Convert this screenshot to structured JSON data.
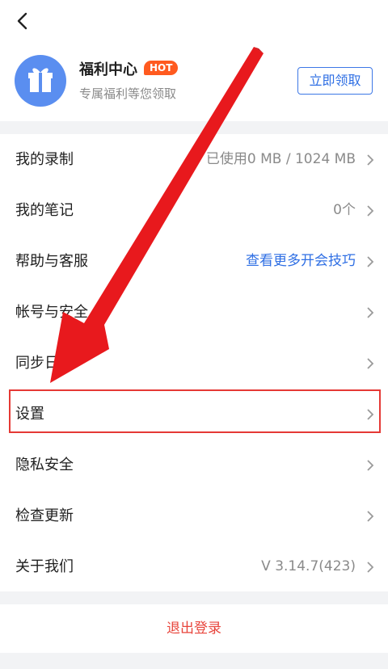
{
  "header": {
    "back_icon": "chevron-left-icon"
  },
  "welfare": {
    "icon": "gift-icon",
    "title": "福利中心",
    "badge": "HOT",
    "subtitle": "专属福利等您领取",
    "claim_button": "立即领取"
  },
  "menu": [
    {
      "label": "我的录制",
      "value": "已使用0 MB / 1024 MB"
    },
    {
      "label": "我的笔记",
      "value": "0个"
    },
    {
      "label": "帮助与客服",
      "value": "查看更多开会技巧",
      "value_is_link": true
    },
    {
      "label": "帐号与安全",
      "value": ""
    },
    {
      "label": "同步日历",
      "value": ""
    },
    {
      "label": "设置",
      "value": "",
      "highlighted": true
    },
    {
      "label": "隐私安全",
      "value": ""
    },
    {
      "label": "检查更新",
      "value": ""
    },
    {
      "label": "关于我们",
      "value": "V 3.14.7(423)"
    }
  ],
  "footer": {
    "logout": "退出登录"
  },
  "colors": {
    "accent_blue": "#2f6fe4",
    "hot_orange": "#ff5a1f",
    "logout_red": "#e8453c",
    "annotation_red": "#e53935"
  }
}
